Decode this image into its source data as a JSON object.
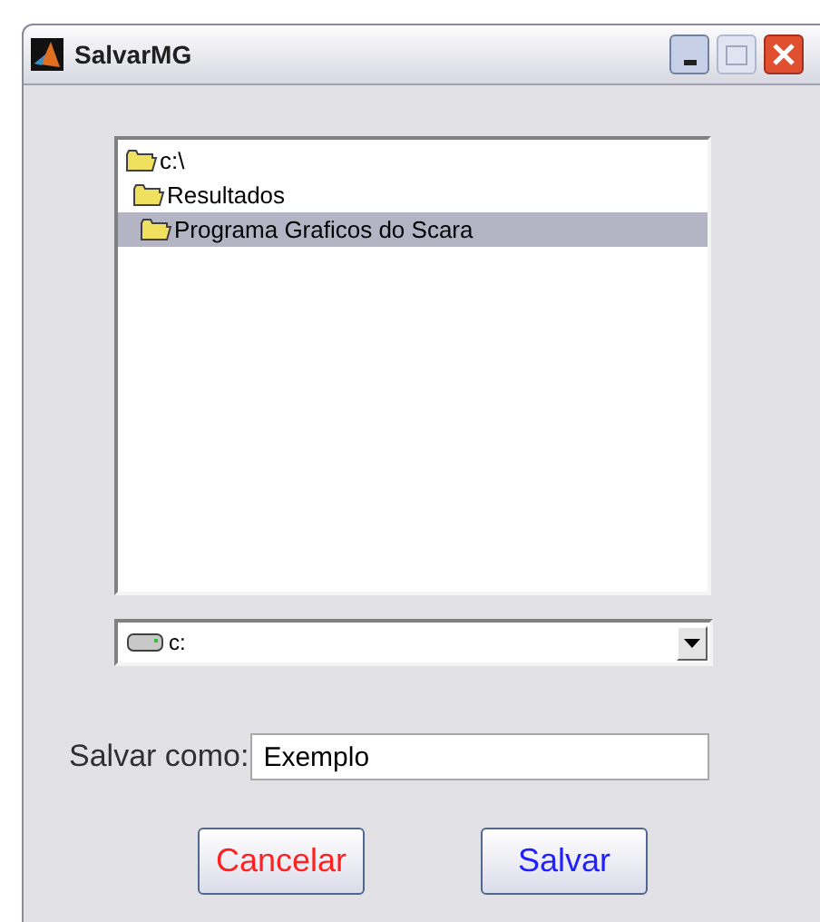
{
  "window": {
    "title": "SalvarMG"
  },
  "folders": [
    {
      "label": "c:\\",
      "selected": false,
      "children": [
        {
          "label": "Resultados",
          "selected": false,
          "children": [
            {
              "label": "Programa Graficos do Scara",
              "selected": true
            }
          ]
        }
      ]
    }
  ],
  "drive": {
    "value": "c:"
  },
  "save_as": {
    "label": "Salvar como:",
    "value": "Exemplo"
  },
  "buttons": [
    {
      "label": "Cancelar",
      "color": "#ff2020"
    },
    {
      "label": "Salvar",
      "color": "#2020ff"
    }
  ]
}
